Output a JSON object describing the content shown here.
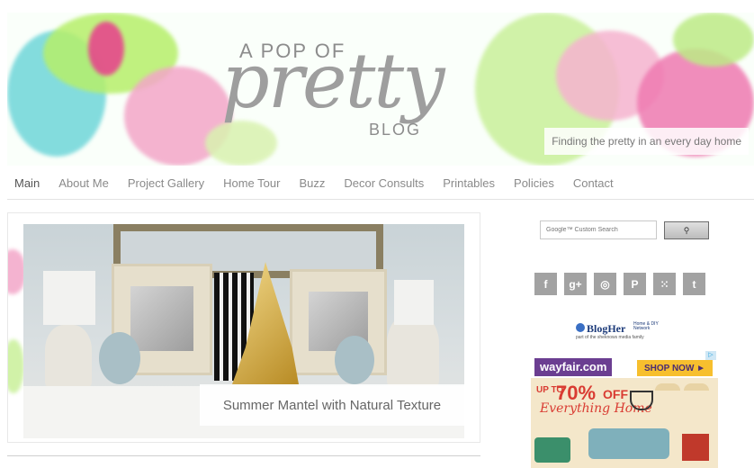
{
  "header": {
    "logo_top": "A POP OF",
    "logo_main": "pretty",
    "logo_bottom": "BLOG",
    "tagline": "Finding the pretty in an every day home"
  },
  "nav": {
    "items": [
      "Main",
      "About Me",
      "Project Gallery",
      "Home Tour",
      "Buzz",
      "Decor Consults",
      "Printables",
      "Policies",
      "Contact"
    ],
    "active": "Main"
  },
  "feature": {
    "caption": "Summer Mantel with Natural Texture"
  },
  "sidebar": {
    "search_placeholder": "Google™ Custom Search",
    "search_button_icon": "search-icon",
    "social_icons": [
      "facebook-icon",
      "google-plus-icon",
      "instagram-icon",
      "pinterest-icon",
      "rss-icon",
      "twitter-icon"
    ],
    "social_glyphs": [
      "f",
      "g+",
      "◎",
      "P",
      "⁙",
      "t"
    ],
    "blogher_name": "BlogHer",
    "blogher_side": "Home & DIY Network",
    "blogher_sub": "part of the sheknows media family"
  },
  "ad": {
    "brand": "wayfair.com",
    "cta": "SHOP NOW ►",
    "choices": "▷",
    "upto": "UP TO",
    "percent": "70%",
    "off": "OFF",
    "tagline": "Everything Home"
  },
  "colors": {
    "nav_text": "#8a8a8a",
    "social_bg": "#a2a2a2",
    "wayfair_purple": "#6b3e91",
    "ad_red": "#d93b32"
  }
}
